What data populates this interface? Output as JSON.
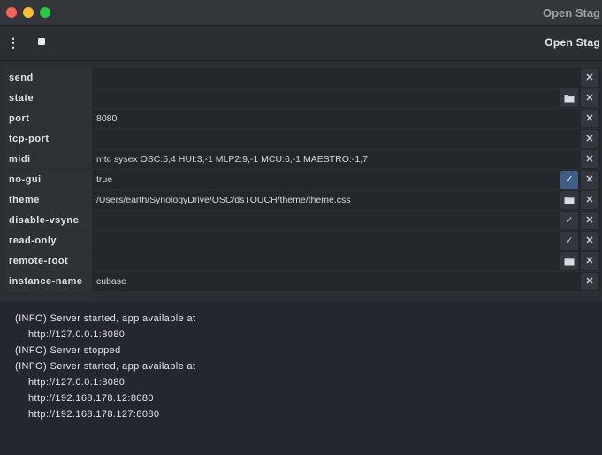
{
  "window": {
    "title": "Open Stag"
  },
  "toolbar": {
    "app_title": "Open Stag",
    "menu_icon": "more-vert-icon",
    "stop_icon": "stop-icon"
  },
  "options": [
    {
      "name": "send",
      "value": "",
      "extra_button": null
    },
    {
      "name": "state",
      "value": "",
      "extra_button": "folder"
    },
    {
      "name": "port",
      "value": "8080",
      "extra_button": null
    },
    {
      "name": "tcp-port",
      "value": "",
      "extra_button": null
    },
    {
      "name": "midi",
      "value": "mtc sysex OSC:5,4 HUI:3,-1 MLP2:9,-1 MCU:6,-1 MAESTRO:-1,7",
      "extra_button": null
    },
    {
      "name": "no-gui",
      "value": "true",
      "extra_button": "check-active"
    },
    {
      "name": "theme",
      "value": "/Users/earth/SynologyDrive/OSC/dsTOUCH/theme/theme.css",
      "extra_button": "folder"
    },
    {
      "name": "disable-vsync",
      "value": "",
      "extra_button": "check"
    },
    {
      "name": "read-only",
      "value": "",
      "extra_button": "check"
    },
    {
      "name": "remote-root",
      "value": "",
      "extra_button": "folder"
    },
    {
      "name": "instance-name",
      "value": "cubase",
      "extra_button": null
    }
  ],
  "icons": {
    "clear": "✕",
    "folder": "📂",
    "check": "✓"
  },
  "colors": {
    "active_toggle": "#3e5d87",
    "background": "#24272d"
  },
  "console": {
    "lines": [
      {
        "text": "(INFO) Server started, app available at",
        "indent": false
      },
      {
        "text": "http://127.0.0.1:8080",
        "indent": true
      },
      {
        "text": "(INFO) Server stopped",
        "indent": false
      },
      {
        "text": "(INFO) Server started, app available at",
        "indent": false
      },
      {
        "text": "http://127.0.0.1:8080",
        "indent": true
      },
      {
        "text": "http://192.168.178.12:8080",
        "indent": true
      },
      {
        "text": "http://192.168.178.127:8080",
        "indent": true
      }
    ]
  }
}
